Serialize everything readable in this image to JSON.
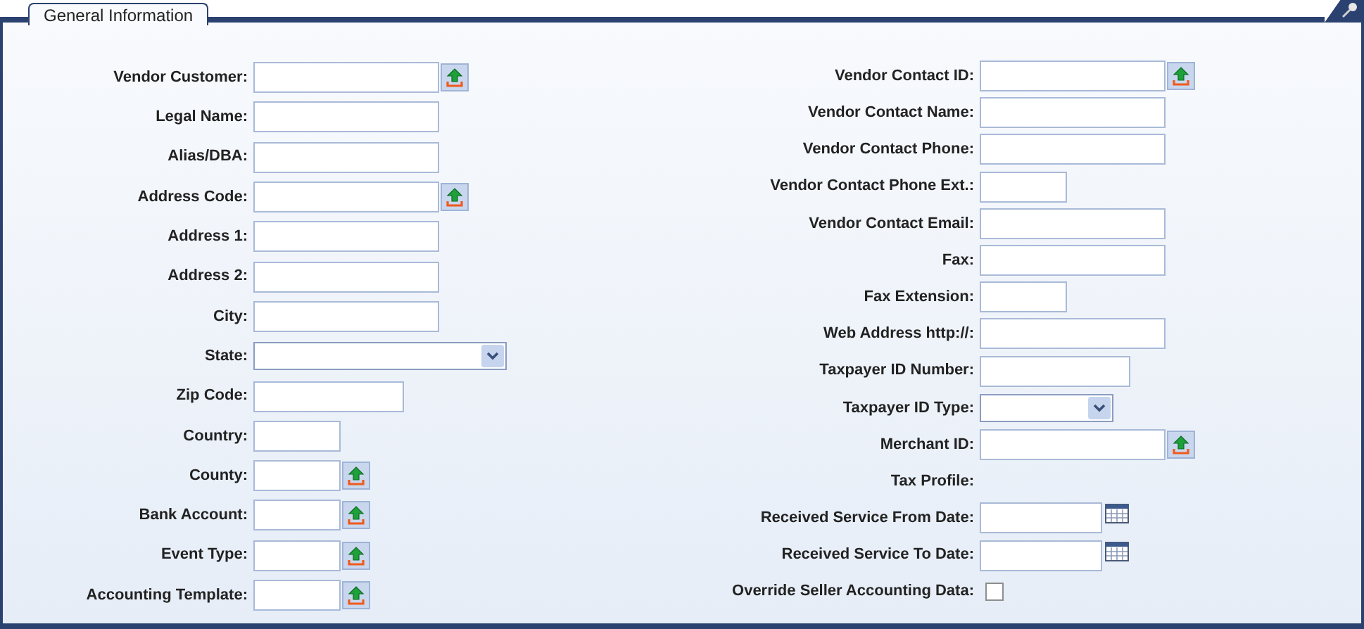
{
  "section": {
    "title": "General Information"
  },
  "left_fields": [
    {
      "label": "Vendor Customer:",
      "kind": "lookup"
    },
    {
      "label": "Legal Name:",
      "kind": "text"
    },
    {
      "label": "Alias/DBA:",
      "kind": "text"
    },
    {
      "label": "Address Code:",
      "kind": "lookup"
    },
    {
      "label": "Address 1:",
      "kind": "text"
    },
    {
      "label": "Address 2:",
      "kind": "text"
    },
    {
      "label": "City:",
      "kind": "text"
    },
    {
      "label": "State:",
      "kind": "select"
    },
    {
      "label": "Zip Code:",
      "kind": "text"
    },
    {
      "label": "Country:",
      "kind": "text"
    },
    {
      "label": "County:",
      "kind": "lookup"
    },
    {
      "label": "Bank Account:",
      "kind": "lookup"
    },
    {
      "label": "Event Type:",
      "kind": "lookup"
    },
    {
      "label": "Accounting Template:",
      "kind": "lookup"
    }
  ],
  "right_fields": [
    {
      "label": "Vendor Contact ID:",
      "kind": "lookup"
    },
    {
      "label": "Vendor Contact Name:",
      "kind": "text"
    },
    {
      "label": "Vendor Contact Phone:",
      "kind": "text"
    },
    {
      "label": "Vendor Contact Phone Ext.:",
      "kind": "text"
    },
    {
      "label": "Vendor Contact Email:",
      "kind": "text"
    },
    {
      "label": "Fax:",
      "kind": "text"
    },
    {
      "label": "Fax Extension:",
      "kind": "text"
    },
    {
      "label": "Web Address http://:",
      "kind": "text"
    },
    {
      "label": "Taxpayer ID Number:",
      "kind": "text"
    },
    {
      "label": "Taxpayer ID Type:",
      "kind": "select"
    },
    {
      "label": "Merchant ID:",
      "kind": "lookup"
    },
    {
      "label": "Tax Profile:",
      "kind": "label"
    },
    {
      "label": "Received Service From Date:",
      "kind": "date"
    },
    {
      "label": "Received Service To Date:",
      "kind": "date"
    },
    {
      "label": "Override Seller Accounting Data:",
      "kind": "checkbox",
      "checked": false
    }
  ]
}
